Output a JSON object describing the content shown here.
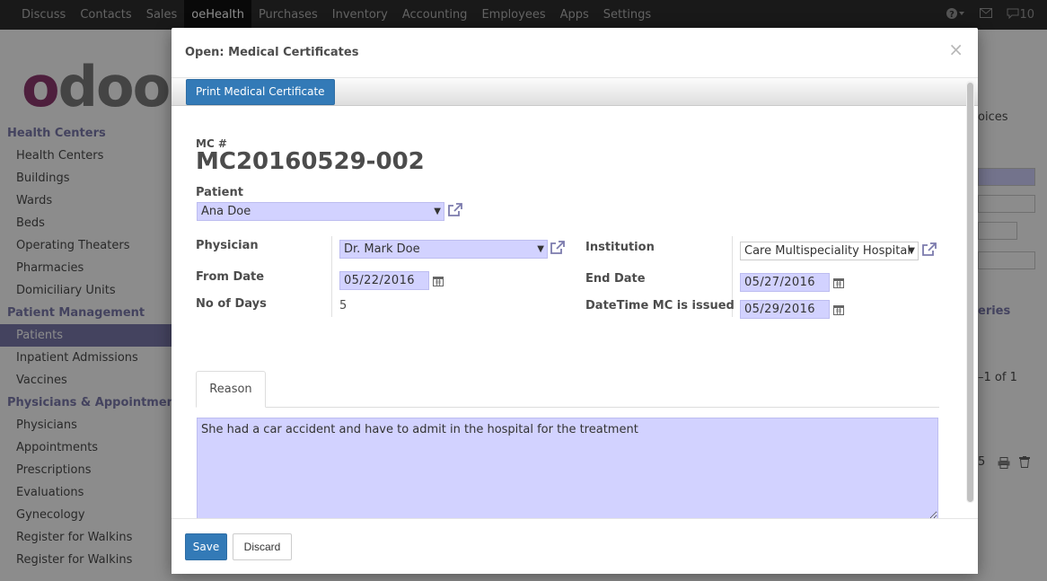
{
  "topbar": {
    "menu": [
      "Discuss",
      "Contacts",
      "Sales",
      "oeHealth",
      "Purchases",
      "Inventory",
      "Accounting",
      "Employees",
      "Apps",
      "Settings"
    ],
    "active": "oeHealth",
    "help_glyph": "?",
    "messages_count": "10"
  },
  "logo": {
    "text": "odoo"
  },
  "sidebar": {
    "sections": [
      {
        "title": "Health Centers",
        "items": [
          "Health Centers",
          "Buildings",
          "Wards",
          "Beds",
          "Operating Theaters",
          "Pharmacies",
          "Domiciliary Units"
        ]
      },
      {
        "title": "Patient Management",
        "items": [
          "Patients",
          "Inpatient Admissions",
          "Vaccines"
        ]
      },
      {
        "title": "Physicians & Appointments",
        "items": [
          "Physicians",
          "Appointments",
          "Prescriptions",
          "Evaluations",
          "Gynecology",
          "Register for Walkins",
          "Register for Walkins"
        ]
      }
    ],
    "active_item": "Patients"
  },
  "background": {
    "fragment_invoices": "oices",
    "fragment_link": "eries",
    "fragment_pager": "–1 of 1",
    "fragment_count": "5"
  },
  "modal": {
    "title": "Open: Medical Certificates",
    "close_glyph": "×",
    "print_button": "Print Medical Certificate",
    "mc_label": "MC #",
    "mc_number": "MC20160529-002",
    "patient_label": "Patient",
    "patient_value": "Ana Doe",
    "physician_label": "Physician",
    "physician_value": "Dr. Mark Doe",
    "institution_label": "Institution",
    "institution_value": "Care Multispeciality Hospital",
    "from_date_label": "From Date",
    "from_date_value": "05/22/2016",
    "end_date_label": "End Date",
    "end_date_value": "05/27/2016",
    "days_label": "No of Days",
    "days_value": "5",
    "issued_label": "DateTime MC is issued",
    "issued_value": "05/29/2016",
    "tab_reason": "Reason",
    "reason_text": "She had a car accident and have to admit in the hospital for the treatment",
    "save_button": "Save",
    "discard_button": "Discard"
  },
  "icons": [
    "external-link-icon",
    "calendar-icon",
    "dropdown-caret-icon",
    "close-icon",
    "help-icon",
    "mail-icon",
    "chat-icon",
    "print-icon",
    "trash-icon"
  ],
  "colors": {
    "accent": "#7c7bad",
    "primary_button": "#337ab7",
    "required_field_bg": "#d2d2ff",
    "navbar": "#2f2f2f"
  }
}
